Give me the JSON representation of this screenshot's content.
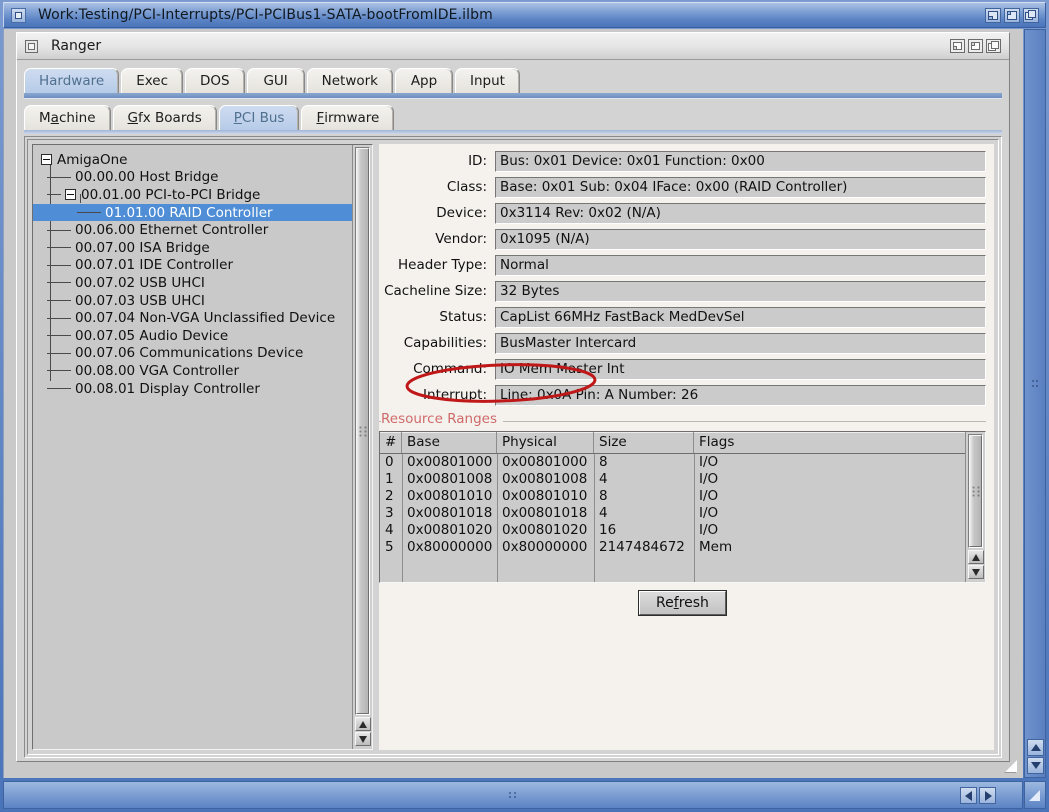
{
  "outer_window": {
    "title": "Work:Testing/PCI-Interrupts/PCI-PCIBus1-SATA-bootFromIDE.ilbm",
    "close_gadget": "close-gadget",
    "gadgets": [
      "depth-gadget",
      "zoom-gadget",
      "front-gadget"
    ]
  },
  "app_window": {
    "title": "Ranger",
    "close_gadget": "close-gadget",
    "gadgets": [
      "depth-gadget",
      "zoom-gadget",
      "front-gadget"
    ]
  },
  "tabs_primary": {
    "active": "Hardware",
    "items": [
      {
        "label": "Hardware",
        "active": true
      },
      {
        "label": "Exec",
        "active": false
      },
      {
        "label": "DOS",
        "active": false
      },
      {
        "label": "GUI",
        "active": false
      },
      {
        "label": "Network",
        "active": false
      },
      {
        "label": "App",
        "active": false
      },
      {
        "label": "Input",
        "active": false
      }
    ]
  },
  "tabs_secondary": {
    "active": "PCI Bus",
    "items": [
      {
        "pre": "M",
        "key": "a",
        "post": "chine",
        "active": false
      },
      {
        "pre": "",
        "key": "G",
        "post": "fx Boards",
        "active": false
      },
      {
        "pre": "",
        "key": "P",
        "post": "CI Bus",
        "active": true
      },
      {
        "pre": "",
        "key": "F",
        "post": "irmware",
        "active": false
      }
    ]
  },
  "tree": {
    "root": "AmigaOne",
    "items": [
      {
        "label": "AmigaOne",
        "depth": 0,
        "node": true,
        "selected": false,
        "last": false
      },
      {
        "label": "00.00.00 Host Bridge",
        "depth": 1,
        "node": false,
        "selected": false,
        "last": false
      },
      {
        "label": "00.01.00 PCI-to-PCI Bridge",
        "depth": 1,
        "node": true,
        "selected": false,
        "last": false
      },
      {
        "label": "01.01.00 RAID Controller",
        "depth": 2,
        "node": false,
        "selected": true,
        "last": true
      },
      {
        "label": "00.06.00 Ethernet Controller",
        "depth": 1,
        "node": false,
        "selected": false,
        "last": false
      },
      {
        "label": "00.07.00 ISA Bridge",
        "depth": 1,
        "node": false,
        "selected": false,
        "last": false
      },
      {
        "label": "00.07.01 IDE Controller",
        "depth": 1,
        "node": false,
        "selected": false,
        "last": false
      },
      {
        "label": "00.07.02 USB UHCI",
        "depth": 1,
        "node": false,
        "selected": false,
        "last": false
      },
      {
        "label": "00.07.03 USB UHCI",
        "depth": 1,
        "node": false,
        "selected": false,
        "last": false
      },
      {
        "label": "00.07.04 Non-VGA Unclassified Device",
        "depth": 1,
        "node": false,
        "selected": false,
        "last": false
      },
      {
        "label": "00.07.05 Audio Device",
        "depth": 1,
        "node": false,
        "selected": false,
        "last": false
      },
      {
        "label": "00.07.06 Communications Device",
        "depth": 1,
        "node": false,
        "selected": false,
        "last": false
      },
      {
        "label": "00.08.00 VGA Controller",
        "depth": 1,
        "node": false,
        "selected": false,
        "last": false
      },
      {
        "label": "00.08.01 Display Controller",
        "depth": 1,
        "node": false,
        "selected": false,
        "last": true
      }
    ]
  },
  "details": {
    "fields": [
      {
        "label": "ID:",
        "value": "Bus: 0x01 Device: 0x01 Function: 0x00"
      },
      {
        "label": "Class:",
        "value": "Base: 0x01 Sub: 0x04 IFace: 0x00 (RAID Controller)"
      },
      {
        "label": "Device:",
        "value": "0x3114 Rev: 0x02 (N/A)"
      },
      {
        "label": "Vendor:",
        "value": "0x1095 (N/A)"
      },
      {
        "label": "Header Type:",
        "value": "Normal"
      },
      {
        "label": "Cacheline Size:",
        "value": "32 Bytes"
      },
      {
        "label": "Status:",
        "value": "CapList 66MHz FastBack MedDevSel"
      },
      {
        "label": "Capabilities:",
        "value": "BusMaster Intercard"
      },
      {
        "label": "Command:",
        "value": "IO Mem Master Int"
      },
      {
        "label": "Interrupt:",
        "value": "Line: 0x0A Pin: A Number: 26"
      }
    ]
  },
  "resource_ranges": {
    "title": "Resource Ranges",
    "columns": [
      "#",
      "Base",
      "Physical",
      "Size",
      "Flags"
    ],
    "rows": [
      [
        "0",
        "0x00801000",
        "0x00801000",
        "8",
        "I/O"
      ],
      [
        "1",
        "0x00801008",
        "0x00801008",
        "4",
        "I/O"
      ],
      [
        "2",
        "0x00801010",
        "0x00801010",
        "8",
        "I/O"
      ],
      [
        "3",
        "0x00801018",
        "0x00801018",
        "4",
        "I/O"
      ],
      [
        "4",
        "0x00801020",
        "0x00801020",
        "16",
        "I/O"
      ],
      [
        "5",
        "0x80000000",
        "0x80000000",
        "2147484672",
        "Mem"
      ]
    ]
  },
  "refresh_button": {
    "pre": "Re",
    "key": "f",
    "post": "resh"
  },
  "annotation": {
    "shape": "ellipse",
    "color": "#c01818",
    "target": "Interrupt:"
  },
  "colors": {
    "title_blue": "#5b83c4",
    "selection_blue": "#4f8ed6",
    "active_tab_blue": "#b6cbe8",
    "panel_gray": "#d3d3d3",
    "field_gray": "#cbcbcb",
    "detail_cream": "#f5f2ee",
    "group_label_red": "#d06a6a",
    "annotation_red": "#c01818"
  }
}
